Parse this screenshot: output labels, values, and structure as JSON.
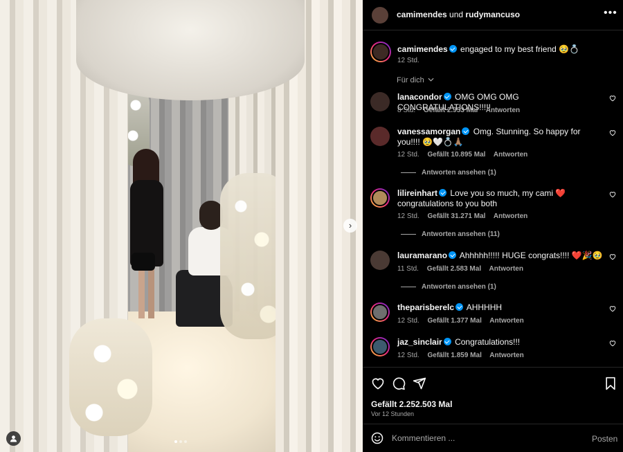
{
  "header": {
    "user1": "camimendes",
    "connector": "und",
    "user2": "rudymancuso",
    "more_label": "•••"
  },
  "caption": {
    "username": "camimendes",
    "text": "engaged to my best friend 🥹💍",
    "time": "12 Std."
  },
  "filter": {
    "label": "Für dich",
    "chevron": "chevron-down-icon"
  },
  "comments": [
    {
      "username": "lanacondor",
      "text": "OMG OMG OMG CONGRATULATIONS!!!!!",
      "time": "8 Std.",
      "likes": "Gefällt 2.953 Mal",
      "reply": "Antworten",
      "avatar_color": "#3b2a26"
    },
    {
      "username": "vanessamorgan",
      "text": "Omg. Stunning. So happy for you!!!! 🥹🤍💍🙏🏽",
      "time": "12 Std.",
      "likes": "Gefällt 10.895 Mal",
      "reply": "Antworten",
      "view_replies": "Antworten ansehen (1)",
      "avatar_color": "#5a2a2a"
    },
    {
      "username": "lilireinhart",
      "text": "Love you so much, my cami ❤️ congratulations to you both",
      "time": "12 Std.",
      "likes": "Gefällt 31.271 Mal",
      "reply": "Antworten",
      "view_replies": "Antworten ansehen (11)",
      "avatar_color": "#b08a5a"
    },
    {
      "username": "lauramarano",
      "text": "Ahhhhh!!!!! HUGE congrats!!!! ❤️🎉🥹",
      "time": "11 Std.",
      "likes": "Gefällt 2.583 Mal",
      "reply": "Antworten",
      "view_replies": "Antworten ansehen (1)",
      "avatar_color": "#4a3a34"
    },
    {
      "username": "theparisberelc",
      "text": "AHHHHH",
      "time": "12 Std.",
      "likes": "Gefällt 1.377 Mal",
      "reply": "Antworten",
      "avatar_color": "#6e6e6e"
    },
    {
      "username": "jaz_sinclair",
      "text": "Congratulations!!!",
      "time": "12 Std.",
      "likes": "Gefällt 1.859 Mal",
      "reply": "Antworten",
      "avatar_color": "#3d5a6e"
    }
  ],
  "post": {
    "likes": "Gefällt 2.252.503 Mal",
    "time": "Vor 12 Stunden"
  },
  "composer": {
    "placeholder": "Kommentieren ...",
    "post_label": "Posten"
  },
  "carousel": {
    "next_icon": "chevron-right-icon",
    "slide_count": 3,
    "active_slide": 1
  },
  "colors": {
    "background": "#000000",
    "text": "#f5f5f5",
    "muted": "#a8a8a8",
    "verified": "#0095f6",
    "divider": "#262626"
  }
}
